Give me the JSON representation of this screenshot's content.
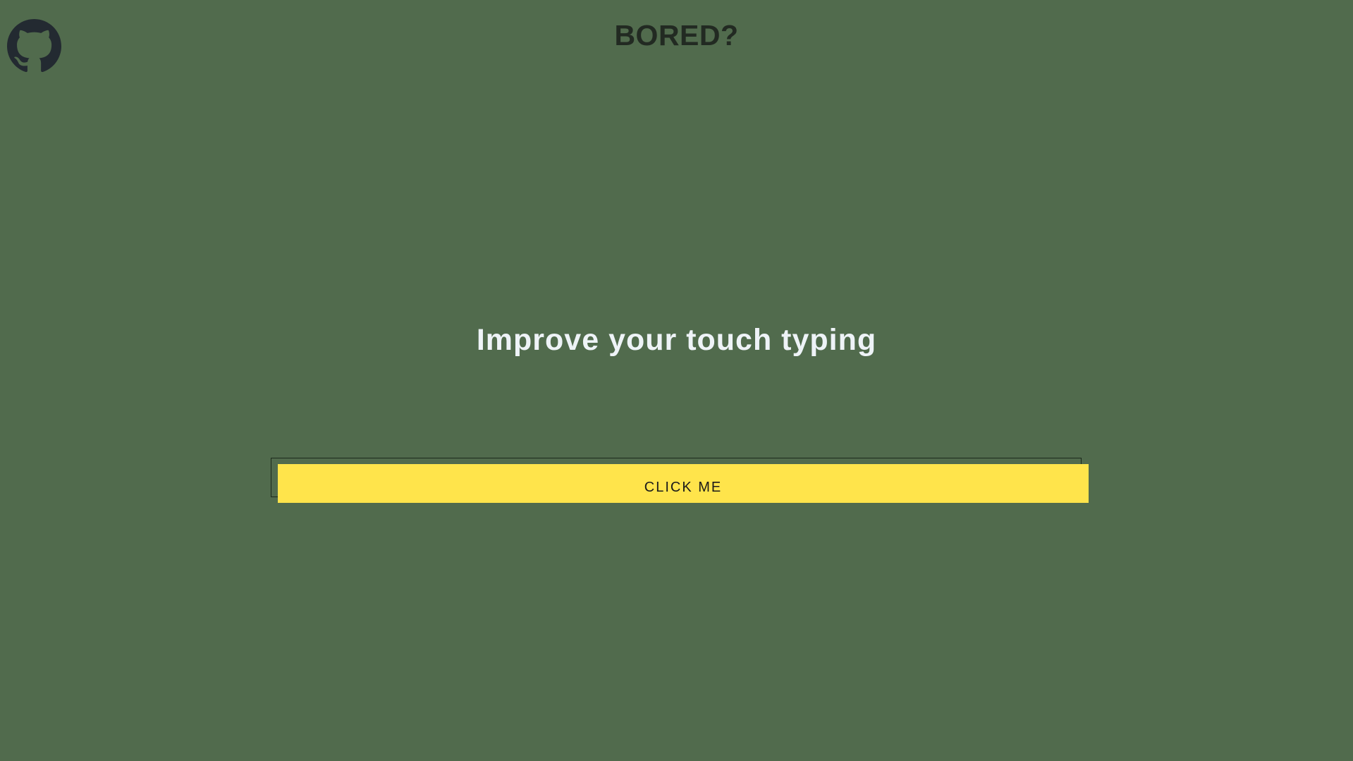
{
  "header": {
    "title": "BORED?",
    "github_icon": "github-icon"
  },
  "main": {
    "activity": "Improve your touch typing",
    "button_label": "CLICK ME"
  },
  "colors": {
    "background": "#516b4d",
    "title": "#222a22",
    "icon": "#232a31",
    "activity_text": "#eef3f7",
    "button_bg": "#ffe44b",
    "button_text": "#1a1a1a"
  }
}
